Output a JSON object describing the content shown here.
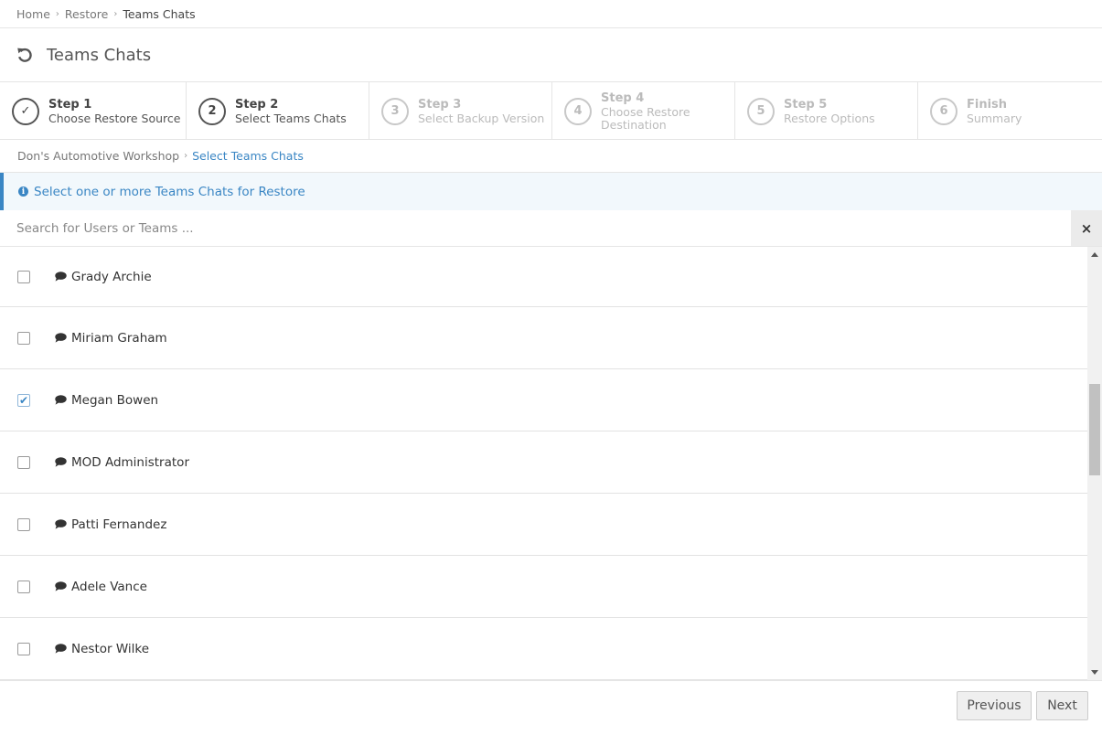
{
  "breadcrumb": [
    "Home",
    "Restore",
    "Teams Chats"
  ],
  "page_title": "Teams Chats",
  "steps": [
    {
      "num": "Step 1",
      "desc": "Choose Restore Source",
      "badge": "✓",
      "state": "done"
    },
    {
      "num": "Step 2",
      "desc": "Select Teams Chats",
      "badge": "2",
      "state": "active"
    },
    {
      "num": "Step 3",
      "desc": "Select Backup Version",
      "badge": "3",
      "state": "pending"
    },
    {
      "num": "Step 4",
      "desc": "Choose Restore Destination",
      "badge": "4",
      "state": "pending"
    },
    {
      "num": "Step 5",
      "desc": "Restore Options",
      "badge": "5",
      "state": "pending"
    },
    {
      "num": "Finish",
      "desc": "Summary",
      "badge": "6",
      "state": "pending"
    }
  ],
  "subcrumb": {
    "org": "Don's Automotive Workshop",
    "current": "Select Teams Chats"
  },
  "info": {
    "icon": "i",
    "text": "Select one or more Teams Chats for Restore"
  },
  "search": {
    "placeholder": "Search for Users or Teams ...",
    "value": "",
    "clear": "×"
  },
  "chats": [
    {
      "name": "Grady Archie",
      "checked": false
    },
    {
      "name": "Miriam Graham",
      "checked": false
    },
    {
      "name": "Megan Bowen",
      "checked": true
    },
    {
      "name": "MOD Administrator",
      "checked": false
    },
    {
      "name": "Patti Fernandez",
      "checked": false
    },
    {
      "name": "Adele Vance",
      "checked": false
    },
    {
      "name": "Nestor Wilke",
      "checked": false
    }
  ],
  "checkmark": "✔",
  "buttons": {
    "previous": "Previous",
    "next": "Next"
  },
  "icons": {
    "restore": "restore-icon",
    "chat": "chat-bubble-icon",
    "info": "info-icon",
    "close": "close-icon"
  },
  "colors": {
    "accent": "#3a86c4",
    "info_bg": "#f2f8fc",
    "button_bg": "#efefef"
  }
}
